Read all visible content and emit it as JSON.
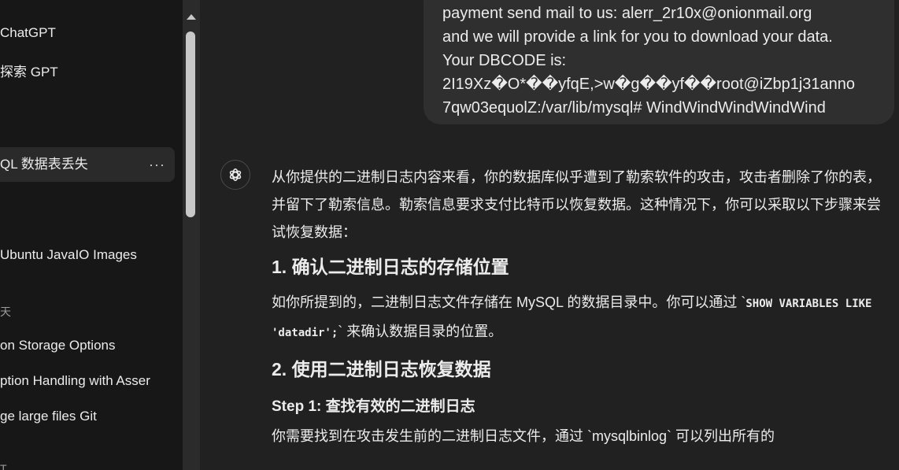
{
  "sidebar": {
    "items": [
      {
        "label": "ChatGPT"
      },
      {
        "label": "探索 GPT"
      },
      {
        "label": "QL 数据表丢失",
        "more": "···"
      },
      {
        "label": "Ubuntu JavaIO Images"
      },
      {
        "label": "天"
      },
      {
        "label": "on Storage Options"
      },
      {
        "label": "ption Handling with Asser"
      },
      {
        "label": "ge large files Git"
      },
      {
        "label": "T"
      }
    ]
  },
  "user_message": {
    "lines": [
      "payment send mail to us: alerr_2r10x@onionmail.org",
      "and we will provide a link for you to download your data.",
      "Your DBCODE is:",
      "2I19Xz�O*��yfqE,>w�g��yf��root@iZbp1j31anno",
      "7qw03equolZ:/var/lib/mysql# WindWindWindWindWind"
    ]
  },
  "assistant": {
    "intro": "从你提供的二进制日志内容来看，你的数据库似乎遭到了勒索软件的攻击，攻击者删除了你的表，并留下了勒索信息。勒索信息要求支付比特币以恢复数据。这种情况下，你可以采取以下步骤来尝试恢复数据：",
    "heading1": "1. 确认二进制日志的存储位置",
    "para1_before": "如你所提到的，二进制日志文件存储在 MySQL 的数据目录中。你可以通过 `",
    "para1_code": "SHOW VARIABLES LIKE 'datadir';",
    "para1_after": "` 来确认数据目录的位置。",
    "heading2": "2. 使用二进制日志恢复数据",
    "step1": "Step 1: 查找有效的二进制日志",
    "para2": "你需要找到在攻击发生前的二进制日志文件，通过 `mysqlbinlog` 可以列出所有的"
  },
  "colors": {
    "background": "#212121",
    "sidebar": "#171717",
    "bubble": "#2f2f2f",
    "text": "#ececec"
  },
  "icons": {
    "avatar": "openai-logo-icon",
    "more": "more-horizontal-icon",
    "scroll_up": "scroll-up-arrow-icon"
  }
}
